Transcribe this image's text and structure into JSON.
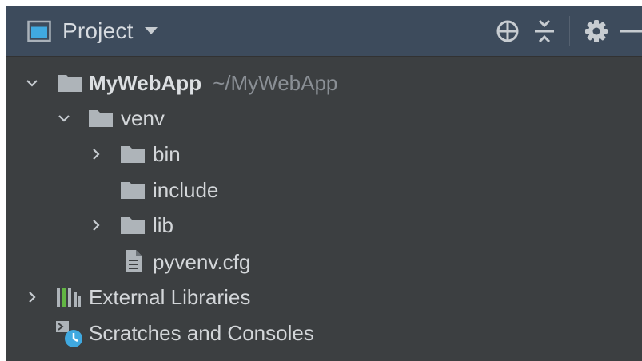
{
  "header": {
    "title": "Project",
    "project_view_icon": "project-window-icon",
    "dropdown_icon": "chevron-down-icon",
    "tools": [
      {
        "name": "select-opened-file-icon"
      },
      {
        "name": "collapse-all-icon"
      },
      {
        "name": "gear-icon"
      },
      {
        "name": "hide-icon"
      }
    ]
  },
  "tree": {
    "root": {
      "label": "MyWebApp",
      "path": "~/MyWebApp",
      "expanded": true,
      "icon": "folder-icon"
    },
    "venv": {
      "label": "venv",
      "expanded": true,
      "icon": "folder-icon"
    },
    "bin": {
      "label": "bin",
      "expanded": false,
      "icon": "folder-icon"
    },
    "include": {
      "label": "include",
      "icon": "folder-icon"
    },
    "lib": {
      "label": "lib",
      "expanded": false,
      "icon": "folder-icon"
    },
    "cfg": {
      "label": "pyvenv.cfg",
      "icon": "text-file-icon"
    },
    "external": {
      "label": "External Libraries",
      "expanded": false,
      "icon": "library-icon"
    },
    "scratches": {
      "label": "Scratches and Consoles",
      "icon": "scratches-icon"
    }
  },
  "colors": {
    "header_bg": "#3d4b5c",
    "panel_bg": "#3c3f41",
    "text": "#d3d6d9",
    "muted_text": "#8a8f95",
    "folder": "#aeb4b9",
    "accent_blue": "#40a9e0"
  }
}
